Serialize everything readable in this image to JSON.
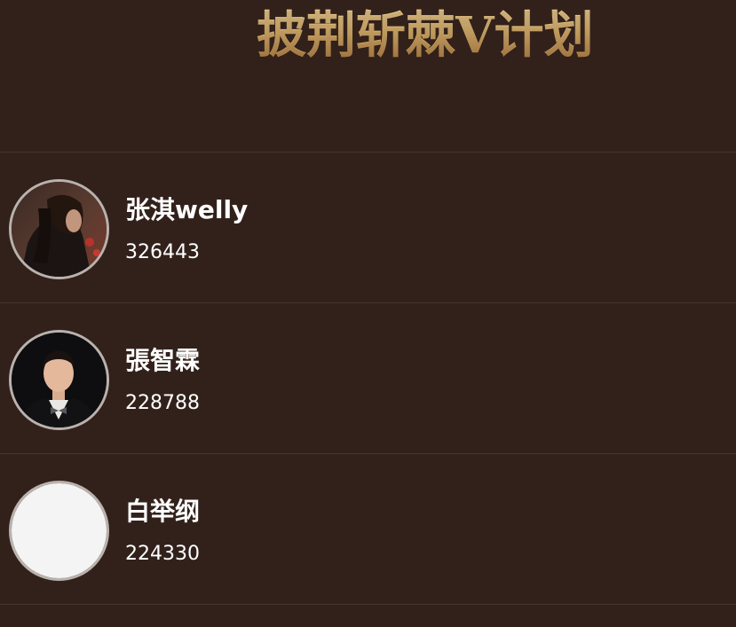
{
  "header": {
    "title": "披荆斩棘V计划"
  },
  "ranking": {
    "items": [
      {
        "name": "张淇welly",
        "score": "326443",
        "avatar": "photo-long-hair-man"
      },
      {
        "name": "張智霖",
        "score": "228788",
        "avatar": "photo-man-bowtie"
      },
      {
        "name": "白举纲",
        "score": "224330",
        "avatar": "blank-placeholder"
      }
    ]
  },
  "colors": {
    "background": "#32211b",
    "divider": "#4a352c",
    "title_gold": "#e0b56f",
    "avatar_border": "#b9b2ad"
  }
}
